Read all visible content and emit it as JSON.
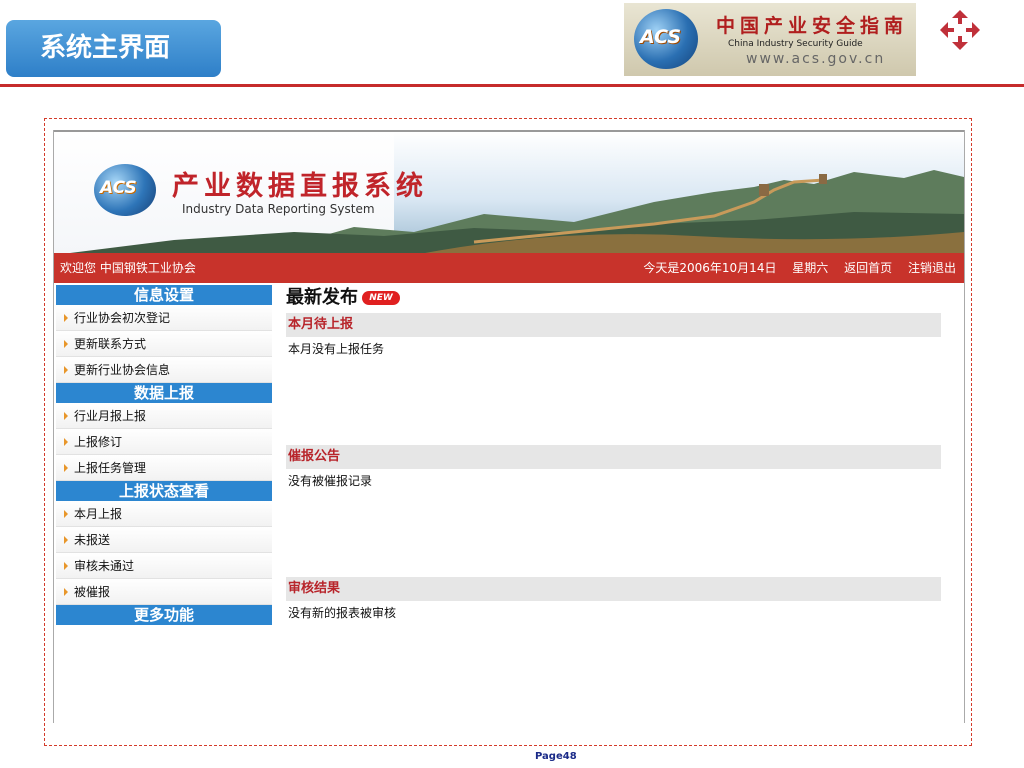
{
  "slide": {
    "title": "系统主界面",
    "page": "Page48"
  },
  "guide_logo": {
    "badge": "ACS",
    "title_cn": "中国产业安全指南",
    "title_en": "China Industry Security Guide",
    "url": "www.acs.gov.cn"
  },
  "app": {
    "badge": "ACS",
    "title_cn": "产业数据直报系统",
    "title_en": "Industry Data Reporting System",
    "welcome": "欢迎您 中国钢铁工业协会",
    "date_text": "今天是2006年10月14日",
    "weekday": "星期六",
    "home_link": "返回首页",
    "logout_link": "注销退出"
  },
  "sidebar": {
    "sections": [
      {
        "title": "信息设置",
        "items": [
          "行业协会初次登记",
          "更新联系方式",
          "更新行业协会信息"
        ]
      },
      {
        "title": "数据上报",
        "items": [
          "行业月报上报",
          "上报修订",
          "上报任务管理"
        ]
      },
      {
        "title": "上报状态查看",
        "items": [
          "本月上报",
          "未报送",
          "审核未通过",
          "被催报"
        ]
      },
      {
        "title": "更多功能",
        "items": []
      }
    ]
  },
  "main": {
    "title": "最新发布",
    "new_badge": "NEW",
    "sections": [
      {
        "title": "本月待上报",
        "text": "本月没有上报任务"
      },
      {
        "title": "催报公告",
        "text": "没有被催报记录"
      },
      {
        "title": "审核结果",
        "text": "没有新的报表被审核"
      }
    ]
  },
  "colors": {
    "accent_blue": "#2c86d0",
    "header_red": "#c8332b",
    "section_red_text": "#b8242a"
  }
}
